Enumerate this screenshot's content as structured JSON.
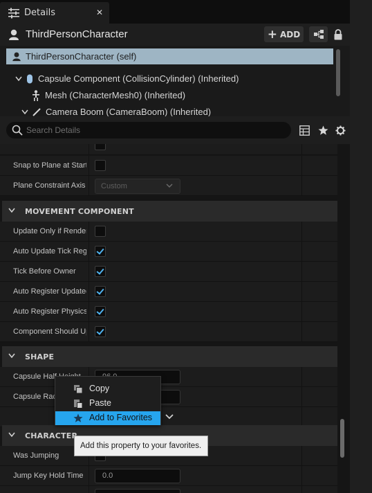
{
  "tab": {
    "title": "Details",
    "close_glyph": "✕"
  },
  "actor": {
    "name": "ThirdPersonCharacter",
    "add_label": "ADD"
  },
  "tree": [
    {
      "label": "ThirdPersonCharacter (self)"
    },
    {
      "label": "Capsule Component (CollisionCylinder) (Inherited)"
    },
    {
      "label": "Mesh (CharacterMesh0) (Inherited)"
    },
    {
      "label": "Camera Boom (CameraBoom) (Inherited)"
    }
  ],
  "search": {
    "placeholder": "Search Details"
  },
  "rows_top": [
    {
      "name": "Snap to Plane at Start",
      "type": "checkbox",
      "checked": false
    },
    {
      "name": "Plane Constraint Axis",
      "type": "select",
      "value": "Custom"
    }
  ],
  "sections": {
    "movement": "MOVEMENT COMPONENT",
    "shape": "SHAPE",
    "character": "CHARACTER"
  },
  "movement_rows": [
    {
      "name": "Update Only if Rendered",
      "checked": false
    },
    {
      "name": "Auto Update Tick Registration",
      "checked": true
    },
    {
      "name": "Tick Before Owner",
      "checked": true
    },
    {
      "name": "Auto Register Updated Component",
      "checked": true
    },
    {
      "name": "Auto Register Physics Volume Updates",
      "checked": true
    },
    {
      "name": "Component Should Update Physics Volume",
      "checked": true
    }
  ],
  "shape_rows": [
    {
      "name": "Capsule Half Height",
      "value": "96.0"
    },
    {
      "name": "Capsule Radius",
      "value": ""
    }
  ],
  "character_rows": [
    {
      "name": "Was Jumping"
    },
    {
      "name": "Jump Key Hold Time",
      "value": "0.0"
    }
  ],
  "context_menu": {
    "items": [
      {
        "label": "Copy",
        "icon": "copy-icon"
      },
      {
        "label": "Paste",
        "icon": "paste-icon"
      },
      {
        "label": "Add to Favorites",
        "icon": "star-icon",
        "highlighted": true
      }
    ]
  },
  "tooltip": {
    "text": "Add this property to your favorites."
  },
  "colors": {
    "accent": "#26a5ee",
    "check": "#4fb3f0",
    "selected_row": "#9eb5c4"
  }
}
